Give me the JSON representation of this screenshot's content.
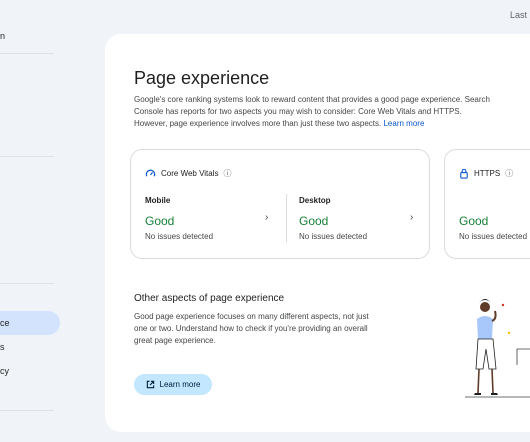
{
  "header": {
    "partial_text": "Last"
  },
  "sidebar": {
    "items": [
      {
        "label": "n"
      },
      {
        "label": "ce"
      },
      {
        "label": "s"
      },
      {
        "label": "cy"
      }
    ]
  },
  "main": {
    "title": "Page experience",
    "description": "Google's core ranking systems look to reward content that provides a good page experience. Search Console has reports for two aspects you may wish to consider: Core Web Vitals and HTTPS. However, page experience involves more than just these two aspects.",
    "learn_more_link": "Learn more",
    "cwv": {
      "title": "Core Web Vitals",
      "mobile": {
        "label": "Mobile",
        "status": "Good",
        "detail": "No issues detected"
      },
      "desktop": {
        "label": "Desktop",
        "status": "Good",
        "detail": "No issues detected"
      }
    },
    "https": {
      "title": "HTTPS",
      "status": "Good",
      "detail": "No issues detected"
    },
    "other": {
      "title": "Other aspects of page experience",
      "description": "Good page experience focuses on many different aspects, not just one or two. Understand how to check if you're providing an overall great page experience.",
      "button_label": "Learn more"
    }
  },
  "colors": {
    "accent": "#0b57d0",
    "good": "#188038",
    "button_bg": "#c2e7ff"
  }
}
